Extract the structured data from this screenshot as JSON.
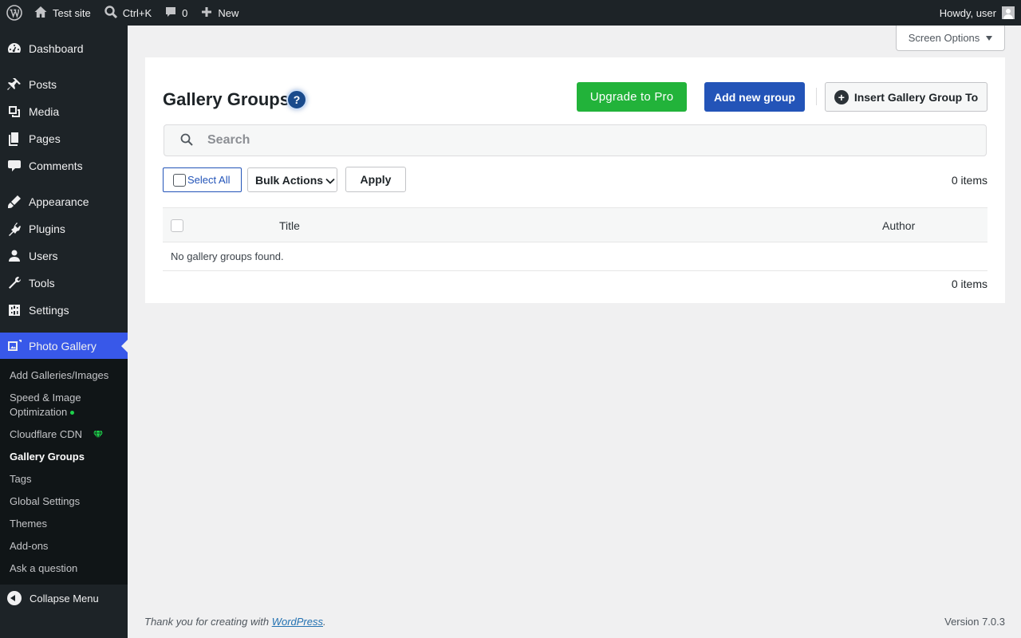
{
  "adminbar": {
    "site_name": "Test site",
    "search_shortcut": "Ctrl+K",
    "comments_count": "0",
    "new_label": "New",
    "greeting": "Howdy, user"
  },
  "screen_options": {
    "label": "Screen Options"
  },
  "sidebar": {
    "items": [
      {
        "label": "Dashboard",
        "icon": "dashboard-icon"
      },
      {
        "label": "Posts",
        "icon": "pin-icon"
      },
      {
        "label": "Media",
        "icon": "media-icon"
      },
      {
        "label": "Pages",
        "icon": "pages-icon"
      },
      {
        "label": "Comments",
        "icon": "comment-icon"
      },
      {
        "label": "Appearance",
        "icon": "brush-icon"
      },
      {
        "label": "Plugins",
        "icon": "plugin-icon"
      },
      {
        "label": "Users",
        "icon": "user-icon"
      },
      {
        "label": "Tools",
        "icon": "wrench-icon"
      },
      {
        "label": "Settings",
        "icon": "settings-icon"
      },
      {
        "label": "Photo Gallery",
        "icon": "photo-gallery-icon"
      }
    ],
    "submenu": [
      {
        "label": "Add Galleries/Images"
      },
      {
        "label": "Speed & Image"
      },
      {
        "label": "Optimization"
      },
      {
        "label": "Cloudflare CDN"
      },
      {
        "label": "Gallery Groups"
      },
      {
        "label": "Tags"
      },
      {
        "label": "Global Settings"
      },
      {
        "label": "Themes"
      },
      {
        "label": "Add-ons"
      },
      {
        "label": "Ask a question"
      }
    ],
    "collapse_label": "Collapse Menu"
  },
  "main": {
    "title": "Gallery Groups",
    "help_label": "?",
    "upgrade_label": "Upgrade to Pro",
    "add_group_label": "Add new group",
    "insert_label": "Insert Gallery Group To",
    "search_placeholder": "Search",
    "select_all_label": "Select All",
    "bulk_actions_label": "Bulk Actions",
    "apply_label": "Apply",
    "items_count": "0 items",
    "table": {
      "columns": [
        "Title",
        "Author"
      ],
      "empty_message": "No gallery groups found."
    }
  },
  "footer": {
    "thanks_prefix": "Thank you for creating with ",
    "thanks_link": "WordPress",
    "thanks_suffix": ".",
    "version": "Version 7.0.3"
  },
  "colors": {
    "accent": "#3858e9",
    "upgrade": "#22b33a",
    "primary_button": "#2354b8"
  }
}
